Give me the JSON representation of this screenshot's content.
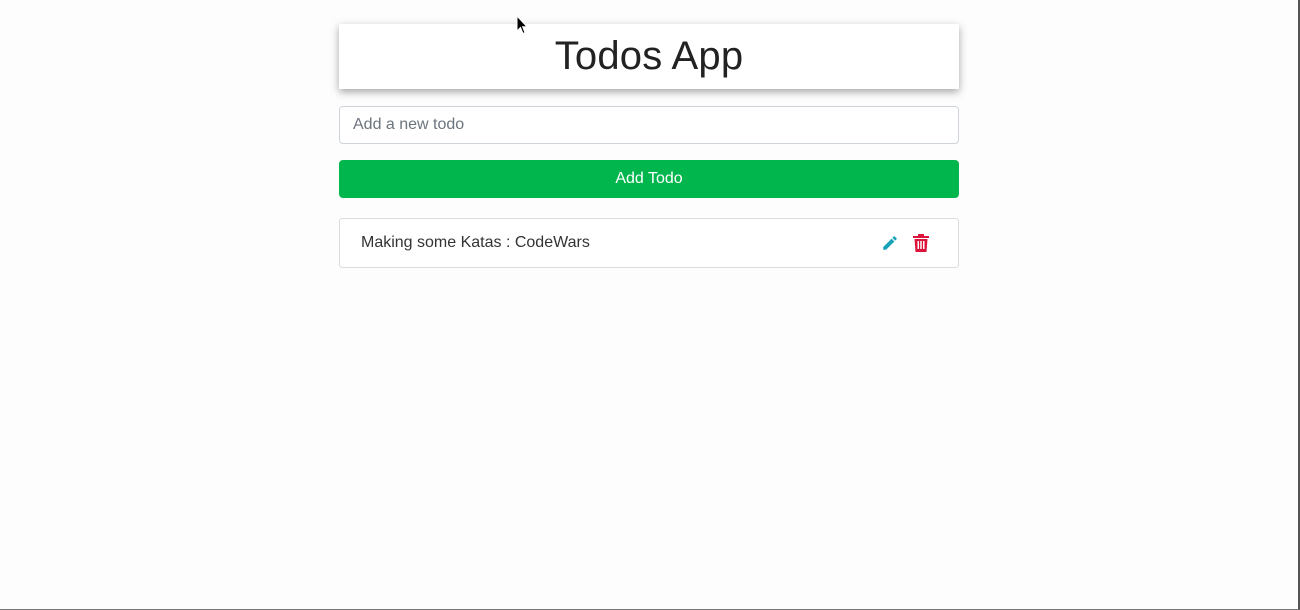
{
  "app": {
    "title": "Todos App"
  },
  "form": {
    "input_placeholder": "Add a new todo",
    "input_value": "",
    "add_button_label": "Add Todo"
  },
  "todos": [
    {
      "text": "Making some Katas : CodeWars",
      "actions": [
        {
          "icon": "pencil-icon",
          "label": "edit",
          "color": "#17a2b8"
        },
        {
          "icon": "trash-icon",
          "label": "delete",
          "color": "#dc143c"
        }
      ]
    }
  ],
  "colors": {
    "accent_green": "#01b74d",
    "edit_icon": "#17a2b8",
    "delete_icon": "#dc143c"
  }
}
